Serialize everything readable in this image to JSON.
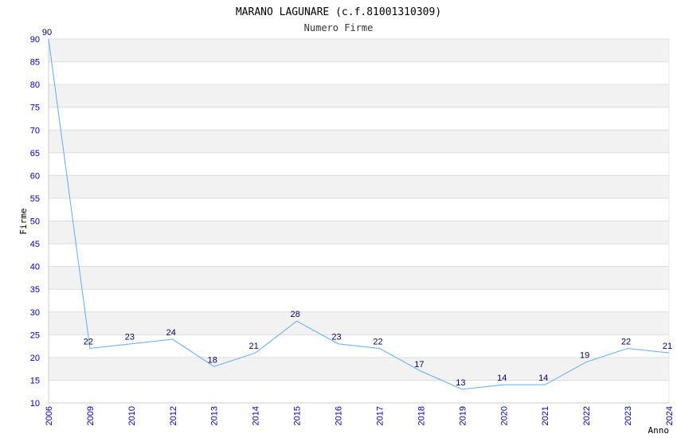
{
  "chart_data": {
    "type": "line",
    "title": "MARANO LAGUNARE (c.f.81001310309)",
    "subtitle": "Numero Firme",
    "xlabel": "Anno",
    "ylabel": "Firme",
    "ylim": [
      10,
      90
    ],
    "ytick_step": 5,
    "grid": "horizontal bands",
    "categories": [
      "2006",
      "2009",
      "2010",
      "2012",
      "2013",
      "2014",
      "2015",
      "2016",
      "2017",
      "2018",
      "2019",
      "2020",
      "2021",
      "2022",
      "2023",
      "2024"
    ],
    "values": [
      90,
      22,
      23,
      24,
      18,
      21,
      28,
      23,
      22,
      17,
      13,
      14,
      14,
      19,
      22,
      21
    ],
    "colors": {
      "line": "#66aaee",
      "band": "#f2f2f2",
      "grid": "#dddddd",
      "tick": "#0000aa",
      "label": "#000066"
    }
  }
}
